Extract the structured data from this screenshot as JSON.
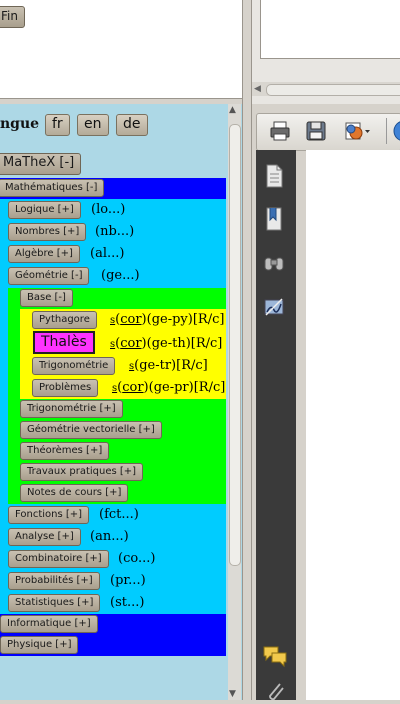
{
  "top": {
    "fin_label": "Fin"
  },
  "lang": {
    "label": "ngue",
    "buttons": [
      "fr",
      "en",
      "de"
    ]
  },
  "mathex_label": "MaTheX [-]",
  "tree": {
    "mathematiques": "Mathématiques [-]",
    "logique": {
      "label": "Logique [+]",
      "code": "(lo...)"
    },
    "nombres": {
      "label": "Nombres [+]",
      "code": "(nb...)"
    },
    "algebre": {
      "label": "Algèbre [+]",
      "code": "(al...)"
    },
    "geometrie": {
      "label": "Géométrie [-]",
      "code": "(ge...)"
    },
    "base": "Base [-]",
    "pythagore": {
      "label": "Pythagore",
      "s": "s",
      "cor": "cor",
      "code": "(ge-py)[R/c]"
    },
    "thales": {
      "label": "Thalès",
      "s": "s",
      "cor": "cor",
      "code": "(ge-th)[R/c]"
    },
    "trigo_item": {
      "label": "Trigonométrie",
      "s": "s",
      "code": "(ge-tr)[R/c]"
    },
    "problemes": {
      "label": "Problèmes",
      "s": "s",
      "cor": "cor",
      "code": "(ge-pr)[R/c]"
    },
    "trigonometrie": "Trigonométrie [+]",
    "geo_vectorielle": "Géométrie vectorielle [+]",
    "theoremes": "Théorèmes [+]",
    "travaux_pratiques": "Travaux pratiques [+]",
    "notes_de_cours": "Notes de cours [+]",
    "fonctions": {
      "label": "Fonctions [+]",
      "code": "(fct...)"
    },
    "analyse": {
      "label": "Analyse [+]",
      "code": "(an...)"
    },
    "combinatoire": {
      "label": "Combinatoire [+]",
      "code": "(co...)"
    },
    "probabilites": {
      "label": "Probabilités [+]",
      "code": "(pr...)"
    },
    "statistiques": {
      "label": "Statistiques [+]",
      "code": "(st...)"
    },
    "informatique": "Informatique [+]",
    "physique": "Physique [+]"
  },
  "colors": {
    "blue": "#0000ff",
    "cyan": "#00ccff",
    "green": "#00ff00",
    "yellow": "#ffff00",
    "magenta": "#ff33ff",
    "panel": "#add8e6"
  },
  "icons": [
    "page-icon",
    "bookmark-icon",
    "binoculars-icon",
    "signature-icon",
    "comment-icon",
    "attachment-icon"
  ]
}
